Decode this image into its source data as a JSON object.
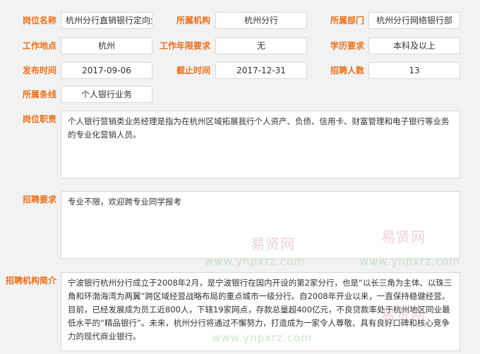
{
  "fields": {
    "post_name": {
      "label": "岗位名称",
      "value": "杭州分行直销银行定向生"
    },
    "org": {
      "label": "所属机构",
      "value": "杭州分行"
    },
    "dept": {
      "label": "所属部门",
      "value": "杭州分行网络银行部"
    },
    "location": {
      "label": "工作地点",
      "value": "杭州"
    },
    "years_req": {
      "label": "工作年限要求",
      "value": "无"
    },
    "edu_req": {
      "label": "学历要求",
      "value": "本科及以上"
    },
    "publish_time": {
      "label": "发布时间",
      "value": "2017-09-06"
    },
    "deadline": {
      "label": "截止时间",
      "value": "2017-12-31"
    },
    "headcount": {
      "label": "招聘人数",
      "value": "13"
    },
    "line": {
      "label": "所属条线",
      "value": "个人银行业务"
    }
  },
  "duty": {
    "label": "岗位职责",
    "text": "个人银行营销类业务经理是指为在杭州区域拓展我行个人资产、负债、信用卡、财富管理和电子银行等业务的专业化营销人员。"
  },
  "requirement": {
    "label": "招聘要求",
    "text": "专业不限，欢迎跨专业同学报考"
  },
  "org_intro": {
    "label": "招聘机构简介",
    "text": "宁波银行杭州分行成立于2008年2月，是宁波银行在国内开设的第2家分行，也是“以长三角为主体、以珠三角和环渤海湾为两翼”跨区域经营战略布局的重点城市一级分行。自2008年开业以来，一直保持稳健经营。目前，已经发展成为员工近800人，下辖19家网点，存款总量超400亿元，不良贷款率处于杭州地区同业最低水平的“精品银行”。未来，杭州分行将通过不懈努力，打造成为一家令人尊敬、具有良好口碑和核心竞争力的现代商业银行。"
  },
  "watermark": {
    "text": "易贤网",
    "url": "www.ynpxrz.com"
  }
}
